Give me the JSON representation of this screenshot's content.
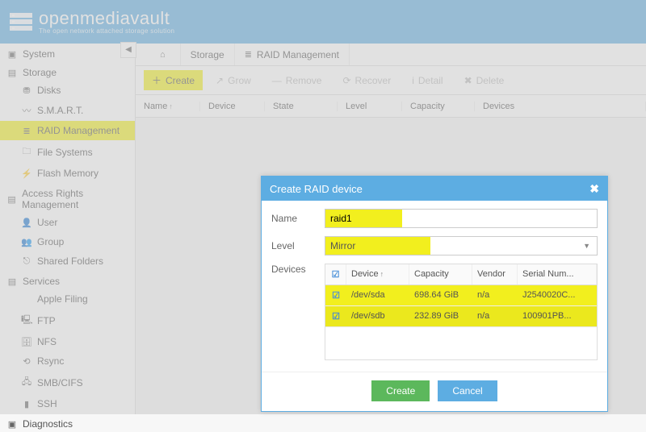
{
  "app": {
    "name": "openmediavault",
    "tagline": "The open network attached storage solution"
  },
  "breadcrumbs": [
    {
      "icon": "home-icon",
      "label": ""
    },
    {
      "icon": "",
      "label": "Storage"
    },
    {
      "icon": "raid-icon",
      "label": "RAID Management"
    }
  ],
  "sidebar": {
    "system": {
      "label": "System"
    },
    "storage": {
      "label": "Storage",
      "disks": "Disks",
      "smart": "S.M.A.R.T.",
      "raid": "RAID Management",
      "fs": "File Systems",
      "flash": "Flash Memory"
    },
    "access": {
      "label": "Access Rights Management",
      "user": "User",
      "group": "Group",
      "shared": "Shared Folders"
    },
    "services": {
      "label": "Services",
      "apple": "Apple Filing",
      "ftp": "FTP",
      "nfs": "NFS",
      "rsync": "Rsync",
      "smb": "SMB/CIFS",
      "ssh": "SSH"
    },
    "diag": {
      "label": "Diagnostics"
    }
  },
  "toolbar": {
    "create": "Create",
    "grow": "Grow",
    "remove": "Remove",
    "recover": "Recover",
    "detail": "Detail",
    "delete": "Delete"
  },
  "grid": {
    "name": "Name",
    "device": "Device",
    "state": "State",
    "level": "Level",
    "capacity": "Capacity",
    "devices": "Devices"
  },
  "modal": {
    "title": "Create RAID device",
    "name_label": "Name",
    "name_value": "raid1",
    "level_label": "Level",
    "level_value": "Mirror",
    "devices_label": "Devices",
    "columns": {
      "device": "Device",
      "capacity": "Capacity",
      "vendor": "Vendor",
      "serial": "Serial Num..."
    },
    "rows": [
      {
        "checked": true,
        "device": "/dev/sda",
        "capacity": "698.64 GiB",
        "vendor": "n/a",
        "serial": "J2540020C..."
      },
      {
        "checked": true,
        "device": "/dev/sdb",
        "capacity": "232.89 GiB",
        "vendor": "n/a",
        "serial": "100901PB..."
      }
    ],
    "create_btn": "Create",
    "cancel_btn": "Cancel"
  }
}
